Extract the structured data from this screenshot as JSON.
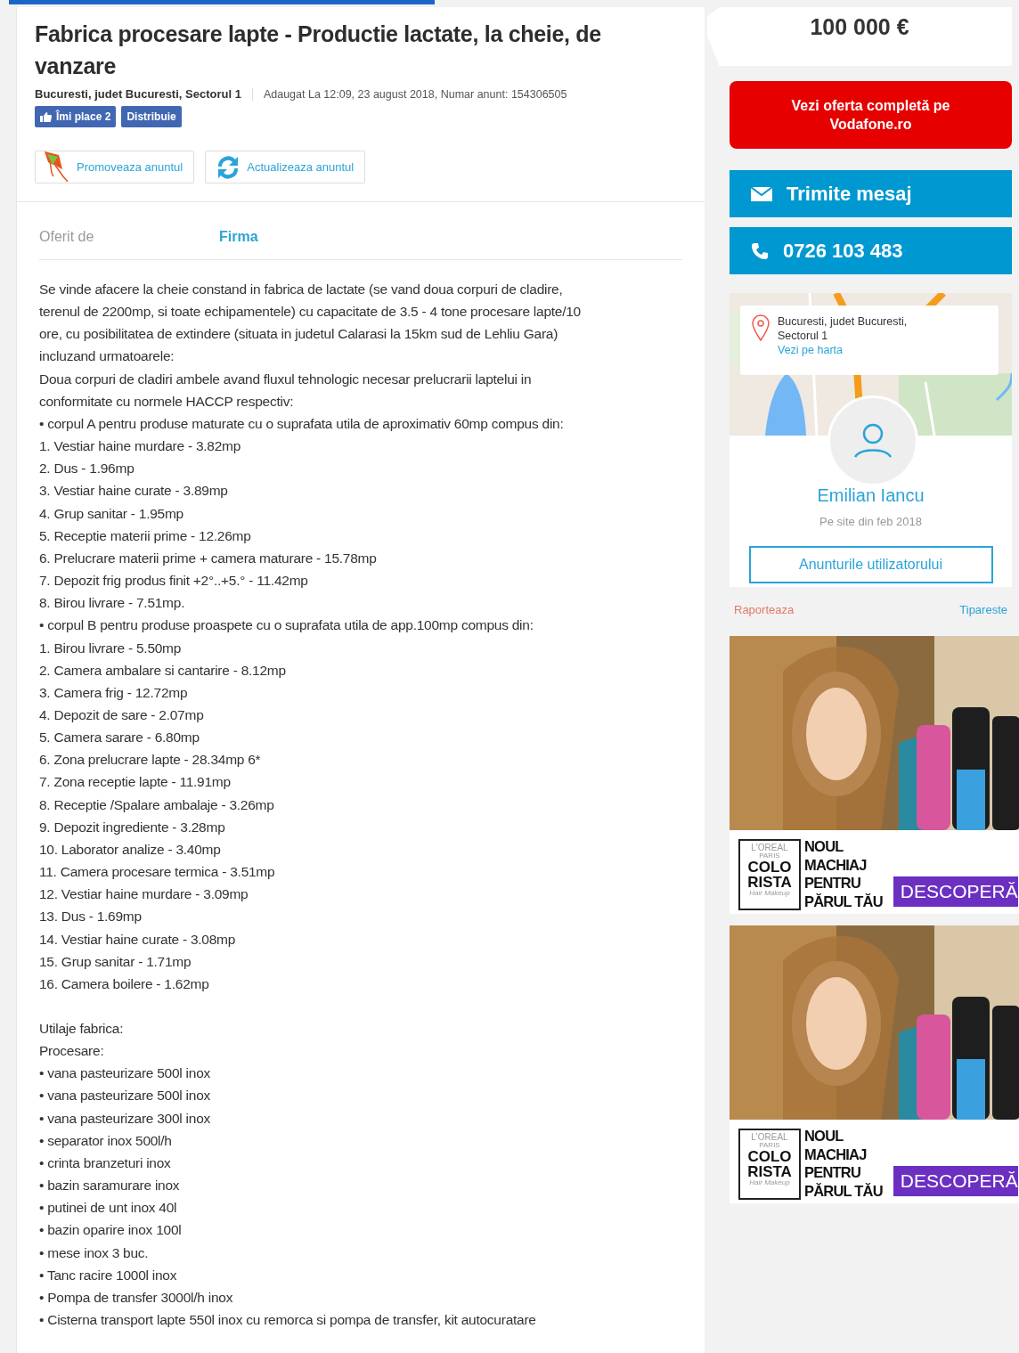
{
  "listing": {
    "title": "Fabrica procesare lapte - Productie lactate, la cheie, de vanzare",
    "location": "Bucuresti, judet Bucuresti, Sectorul 1",
    "added": "Adaugat La 12:09, 23 august 2018, Numar anunt: 154306505",
    "social": [
      {
        "label": "Îmi place 2",
        "kind": "like"
      },
      {
        "label": "Distribuie",
        "kind": "share"
      }
    ],
    "actions": [
      {
        "label": "Promoveaza anuntul",
        "kind": "promote"
      },
      {
        "label": "Actualizeaza anuntul",
        "kind": "refresh"
      }
    ],
    "details": [
      {
        "label": "Oferit de",
        "value": "Firma"
      }
    ],
    "description": [
      [
        "Se vinde afacere la cheie constand in fabrica de lactate (se vand doua corpuri de cladire,",
        "terenul de 2200mp, si toate echipamentele) cu capacitate de 3.5 - 4 tone procesare lapte/10",
        "ore, cu posibilitatea de extindere (situata in judetul Calarasi la 15km sud de Lehliu Gara)",
        "incluzand urmatoarele:",
        "Doua corpuri de cladiri ambele avand fluxul tehnologic necesar prelucrarii laptelui in",
        "conformitate cu normele HACCP respectiv:",
        "• corpul A pentru produse maturate cu o suprafata utila de aproximativ 60mp compus din:",
        "1. Vestiar haine murdare - 3.82mp",
        "2. Dus - 1.96mp",
        "3. Vestiar haine curate - 3.89mp",
        "4. Grup sanitar - 1.95mp",
        "5. Receptie materii prime - 12.26mp",
        "6. Prelucrare materii prime + camera maturare - 15.78mp",
        "7. Depozit frig produs finit +2°..+5.° - 11.42mp",
        "8. Birou livrare - 7.51mp.",
        "• corpul B pentru produse proaspete cu o suprafata utila de app.100mp compus din:",
        "1. Birou livrare - 5.50mp",
        "2. Camera ambalare si cantarire - 8.12mp",
        "3. Camera frig - 12.72mp",
        "4. Depozit de sare - 2.07mp",
        "5. Camera sarare - 6.80mp",
        "6. Zona prelucrare lapte - 28.34mp 6*",
        "7. Zona receptie lapte - 11.91mp",
        "8. Receptie /Spalare ambalaje - 3.26mp",
        "9. Depozit ingrediente - 3.28mp",
        "10. Laborator analize - 3.40mp",
        "11. Camera procesare termica - 3.51mp",
        "12. Vestiar haine murdare - 3.09mp",
        "13. Dus - 1.69mp",
        "14. Vestiar haine curate - 3.08mp",
        "15. Grup sanitar - 1.71mp",
        "16. Camera boilere - 1.62mp"
      ],
      [
        "Utilaje fabrica:",
        "Procesare:",
        "• vana pasteurizare 500l inox",
        "• vana pasteurizare 500l inox",
        "• vana pasteurizare 300l inox",
        "• separator inox 500l/h",
        "• crinta branzeturi inox",
        "• bazin saramurare inox",
        "• putinei de unt inox 40l",
        "• bazin oparire inox 100l",
        "• mese inox 3 buc.",
        "• Tanc racire 1000l inox",
        "• Pompa de transfer 3000l/h inox",
        "• Cisterna transport lapte 550l inox cu remorca si pompa de transfer, kit autocuratare"
      ]
    ]
  },
  "sidebar": {
    "price": "100 000 €",
    "buttons": [
      {
        "label": "Vezi oferta completă pe Vodafone.ro",
        "kind": "promo"
      },
      {
        "label": "Trimite mesaj",
        "kind": "message"
      },
      {
        "label": "0726 103 483",
        "kind": "phone"
      }
    ],
    "map_card": {
      "address": "Bucuresti, judet Bucuresti, Sectorul 1",
      "link": "Vezi pe harta"
    },
    "seller": {
      "name": "Emilian Iancu",
      "since": "Pe site din feb 2018",
      "button": "Anunturile utilizatorului"
    },
    "links": [
      {
        "label": "Raporteaza",
        "kind": "report"
      },
      {
        "label": "Tipareste",
        "kind": "print"
      }
    ],
    "ads": [
      {
        "brand": "L'OREAL",
        "brand_sub": "PARIS",
        "logo": [
          "COLO",
          "RISTA"
        ],
        "logo_script": "Hair Makeup",
        "slogan": [
          "NOUL",
          "MACHIAJ",
          "PENTRU",
          "PĂRUL TĂU"
        ],
        "cta": "DESCOPERĂ"
      },
      {
        "brand": "L'OREAL",
        "brand_sub": "PARIS",
        "logo": [
          "COLO",
          "RISTA"
        ],
        "logo_script": "Hair Makeup",
        "slogan": [
          "NOUL",
          "MACHIAJ",
          "PENTRU",
          "PĂRUL TĂU"
        ],
        "cta": "DESCOPERĂ"
      }
    ]
  }
}
